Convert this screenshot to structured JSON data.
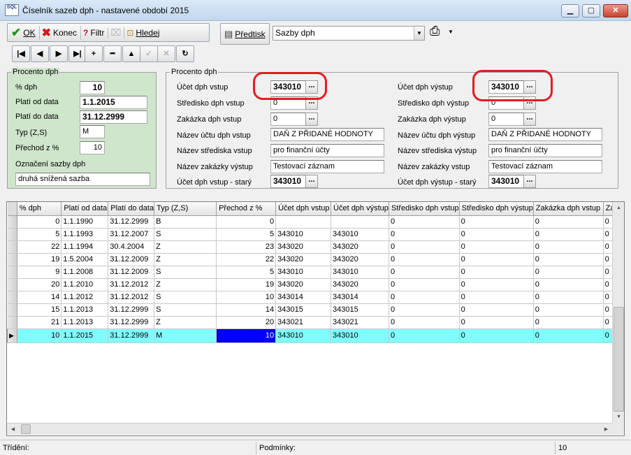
{
  "window": {
    "title": "Číselník sazeb dph - nastavené období 2015",
    "app_icon": "SQL",
    "controls": {
      "minimize": "▁",
      "maximize": "▢",
      "close": "✕"
    }
  },
  "toolbar": {
    "ok_label": "OK",
    "konec_label": "Konec",
    "filtr_label": "Filtr",
    "hledej_label": "Hledej",
    "predtisk_label": "Předtisk",
    "report_select": "Sazby dph"
  },
  "left_panel": {
    "title": "Procento dph",
    "pct_label": "% dph",
    "pct_value": "10",
    "od_label": "Platí od data",
    "od_value": "1.1.2015",
    "do_label": "Platí do data",
    "do_value": "31.12.2999",
    "typ_label": "Typ (Z,S)",
    "typ_value": "M",
    "prechod_label": "Přechod z %",
    "prechod_value": "10",
    "oznaceni_label": "Označení sazby dph",
    "oznaceni_value": "druhá snížená sazba"
  },
  "right_panel": {
    "title": "Procento dph",
    "vstup": {
      "ucet_label": "Účet dph vstup",
      "ucet_value": "343010",
      "stredisko_label": "Středisko dph vstup",
      "stredisko_value": "0",
      "zakazka_label": "Zakázka dph vstup",
      "zakazka_value": "0",
      "nazev_uctu_label": "Název účtu dph vstup",
      "nazev_uctu_value": "DAŇ Z PŘIDANÉ HODNOTY",
      "nazev_strediska_label": "Název střediska vstup",
      "nazev_strediska_value": "pro finanční účty",
      "nazev_zakazky_label": "Název zakázky výstup",
      "nazev_zakazky_value": "Testovací záznam",
      "stary_label": "Účet dph vstup - starý",
      "stary_value": "343010"
    },
    "vystup": {
      "ucet_label": "Účet dph výstup",
      "ucet_value": "343010",
      "stredisko_label": "Středisko dph výstup",
      "stredisko_value": "0",
      "zakazka_label": "Zakázka dph výstup",
      "zakazka_value": "0",
      "nazev_uctu_label": "Název účtu dph výstup",
      "nazev_uctu_value": "DAŇ Z PŘIDANÉ HODNOTY",
      "nazev_strediska_label": "Název střediska výstup",
      "nazev_strediska_value": "pro finanční účty",
      "nazev_zakazky_label": "Název zakázky vstup",
      "nazev_zakazky_value": "Testovací záznam",
      "stary_label": "Účet dph výstup - starý",
      "stary_value": "343010"
    },
    "ellipsis": "..."
  },
  "grid": {
    "columns": [
      "% dph",
      "Platí od data",
      "Platí do data",
      "Typ (Z,S)",
      "Přechod z %",
      "Účet dph vstup",
      "Účet dph výstup",
      "Středisko dph vstup",
      "Středisko dph výstup",
      "Zakázka dph vstup",
      "Za"
    ],
    "rows": [
      [
        "0",
        "1.1.1990",
        "31.12.2999",
        "B",
        "0",
        "",
        "",
        "0",
        "0",
        "0",
        "0"
      ],
      [
        "5",
        "1.1.1993",
        "31.12.2007",
        "S",
        "5",
        "343010",
        "343010",
        "0",
        "0",
        "0",
        "0"
      ],
      [
        "22",
        "1.1.1994",
        "30.4.2004",
        "Z",
        "23",
        "343020",
        "343020",
        "0",
        "0",
        "0",
        "0"
      ],
      [
        "19",
        "1.5.2004",
        "31.12.2009",
        "Z",
        "22",
        "343020",
        "343020",
        "0",
        "0",
        "0",
        "0"
      ],
      [
        "9",
        "1.1.2008",
        "31.12.2009",
        "S",
        "5",
        "343010",
        "343010",
        "0",
        "0",
        "0",
        "0"
      ],
      [
        "20",
        "1.1.2010",
        "31.12.2012",
        "Z",
        "19",
        "343020",
        "343020",
        "0",
        "0",
        "0",
        "0"
      ],
      [
        "14",
        "1.1.2012",
        "31.12.2012",
        "S",
        "10",
        "343014",
        "343014",
        "0",
        "0",
        "0",
        "0"
      ],
      [
        "15",
        "1.1.2013",
        "31.12.2999",
        "S",
        "14",
        "343015",
        "343015",
        "0",
        "0",
        "0",
        "0"
      ],
      [
        "21",
        "1.1.2013",
        "31.12.2999",
        "Z",
        "20",
        "343021",
        "343021",
        "0",
        "0",
        "0",
        "0"
      ],
      [
        "10",
        "1.1.2015",
        "31.12.2999",
        "M",
        "10",
        "343010",
        "343010",
        "0",
        "0",
        "0",
        "0"
      ]
    ],
    "selected_row": 9,
    "current_cell_col": 4
  },
  "status": {
    "trideni": "Třídění:",
    "podminky": "Podmínky:",
    "count": "10"
  },
  "colors": {
    "selected_row": "#80ffff",
    "current_cell": "#0000ff",
    "panel_green": "#cfe6cc",
    "annotation_red": "#e01d24"
  }
}
